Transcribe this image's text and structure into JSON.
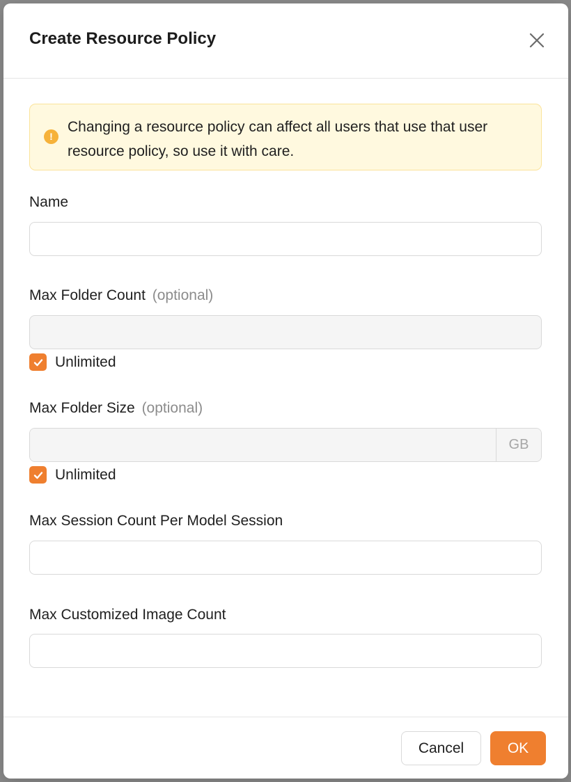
{
  "dialog": {
    "title": "Create Resource Policy",
    "close_icon": "close-icon"
  },
  "alert": {
    "icon": "exclamation-circle-icon",
    "text": "Changing a resource policy can affect all users that use that user resource policy, so use it with care."
  },
  "fields": {
    "name": {
      "label": "Name",
      "value": "",
      "placeholder": ""
    },
    "max_folder_count": {
      "label": "Max Folder Count",
      "optional": "(optional)",
      "value": "",
      "unlimited_label": "Unlimited",
      "unlimited_checked": true
    },
    "max_folder_size": {
      "label": "Max Folder Size",
      "optional": "(optional)",
      "value": "",
      "unit": "GB",
      "unlimited_label": "Unlimited",
      "unlimited_checked": true
    },
    "max_session_count": {
      "label": "Max Session Count Per Model Session",
      "value": ""
    },
    "max_customized_image_count": {
      "label": "Max Customized Image Count",
      "value": ""
    }
  },
  "footer": {
    "cancel_label": "Cancel",
    "ok_label": "OK"
  },
  "colors": {
    "accent": "#ef7f2f",
    "warning_bg": "#fff9df",
    "warning_border": "#fbe39a",
    "warning_icon": "#f6b23a"
  }
}
